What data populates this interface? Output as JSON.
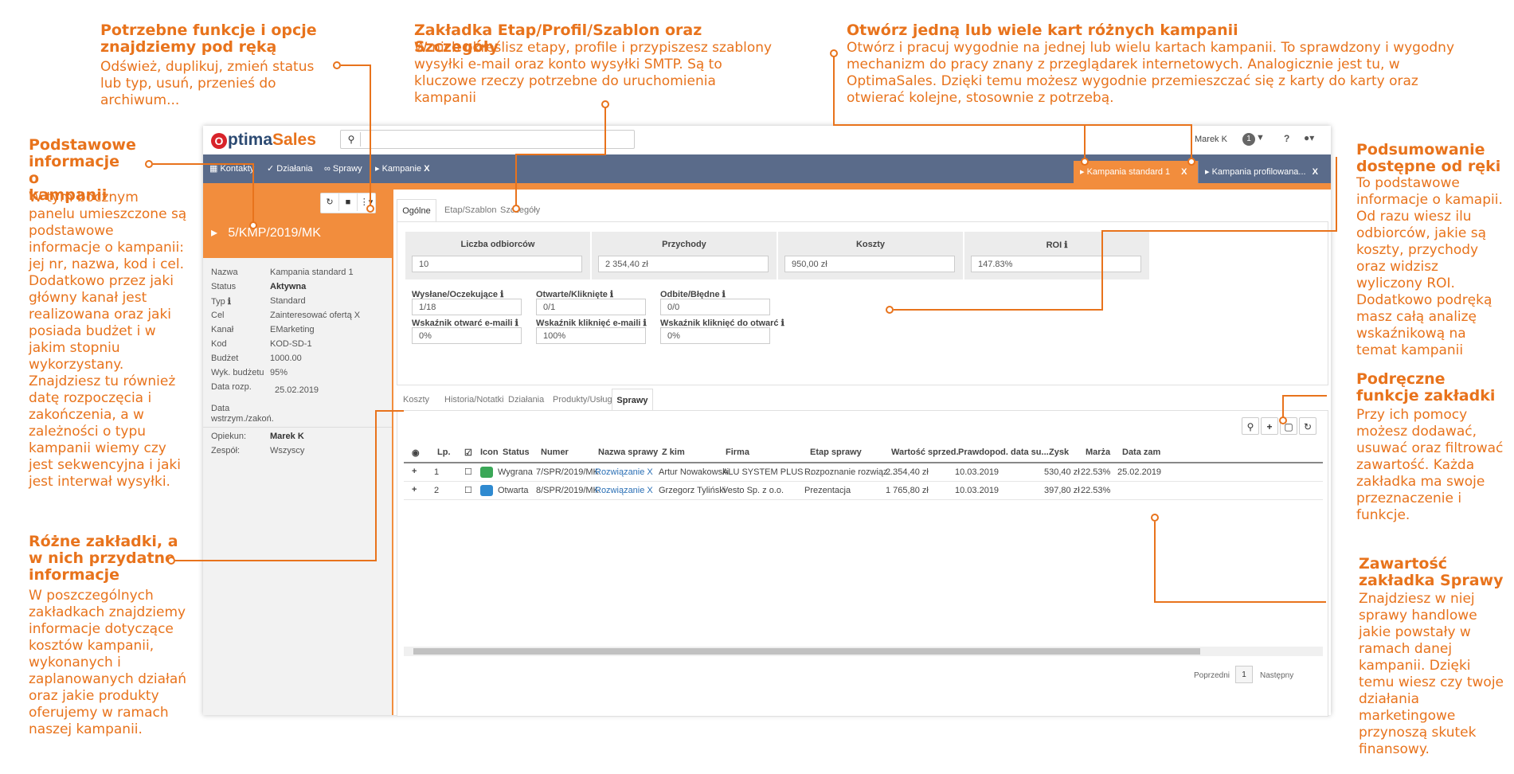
{
  "annotations": {
    "functions": {
      "title": "Potrzebne funkcje i opcje znajdziemy pod ręką",
      "body": "Odśwież, duplikuj, zmień status lub typ, usuń, przenieś do archiwum..."
    },
    "stage_tab": {
      "title": "Zakładka Etap/Profil/Szablon oraz Szczegóły",
      "body": "W nich określisz etapy, profile i przypiszesz szablony wysyłki e-mail oraz konto wysyłki SMTP. Są to kluczowe rzeczy potrzebne do uruchomienia kampanii"
    },
    "open_tabs": {
      "title": "Otwórz jedną lub wiele kart różnych kampanii",
      "body": "Otwórz i pracuj wygodnie na jednej lub wielu kartach kampanii. To sprawdzony i wygodny mechanizm do pracy znany z przeglądarek internetowych. Analogicznie jest tu, w OptimaSales. Dzięki temu możesz wygodnie przemieszczać się z karty do karty oraz otwierać kolejne, stosownie z potrzebą."
    },
    "basic_info": {
      "title": "Podstawowe informacje o kampanii",
      "body": "W tym bocznym panelu umieszczone są podstawowe informacje o kampanii: jej nr, nazwa, kod i cel. Dodatkowo przez jaki główny kanał jest realizowana oraz jaki posiada budżet i w jakim stopniu wykorzystany. Znajdziesz tu również datę rozpoczęcia i zakończenia, a w zależności o typu kampanii wiemy czy jest sekwencyjna i jaki jest interwał wysyłki."
    },
    "summary": {
      "title": "Podsumowanie dostępne od ręki",
      "body": "To podstawowe informacje o kamapii. Od razu wiesz ilu odbiorców, jakie są koszty, przychody oraz widzisz wyliczony ROI. Dodatkowo podręką masz całą analizę wskaźnikową na temat kampanii"
    },
    "handy": {
      "title": "Podręczne funkcje zakładki",
      "body": "Przy ich pomocy możesz dodawać, usuwać oraz filtrować zawartość. Każda zakładka ma swoje przeznaczenie i funkcje."
    },
    "tabs_info": {
      "title": "Różne zakładki, a w nich przydatne informacje",
      "body": "W poszczególnych zakładkach znajdziemy informacje dotyczące kosztów kampanii, wykonanych i zaplanowanych działań oraz jakie produkty oferujemy w ramach naszej kampanii."
    },
    "deals": {
      "title": "Zawartość zakładka Sprawy",
      "body": "Znajdziesz w niej sprawy handlowe jakie powstały w ramach danej kampanii. Dzięki temu wiesz czy twoje działania marketingowe przynoszą skutek finansowy."
    }
  },
  "app": {
    "logo_o": "O",
    "logo_rest_1": "ptima",
    "logo_rest_2": "Sales",
    "user": "Marek K",
    "notif_count": "1",
    "help": "?",
    "nav": [
      "Kontakty",
      "Działania",
      "Sprawy",
      "Kampanie"
    ],
    "nav_close": "X",
    "tab_active": "Kampania standard 1",
    "tab_active_close": "X",
    "tab_inactive": "Kampania profilowana...",
    "tab_inactive_close": "X"
  },
  "campaign": {
    "number": "5/KMP/2019/MK",
    "fields": [
      {
        "label": "Nazwa",
        "value": "Kampania standard 1"
      },
      {
        "label": "Status",
        "value": "Aktywna"
      },
      {
        "label": "Typ",
        "value": "Standard"
      },
      {
        "label": "Cel",
        "value": "Zainteresować ofertą X"
      },
      {
        "label": "Kanał",
        "value": "EMarketing"
      },
      {
        "label": "Kod",
        "value": "KOD-SD-1"
      },
      {
        "label": "Budżet",
        "value": "1000.00"
      },
      {
        "label": "Wyk. budżetu",
        "value": "95%"
      },
      {
        "label": "Data rozp.",
        "value": "25.02.2019"
      },
      {
        "label": "Data wstrzym./zakoń.",
        "value": ""
      },
      {
        "label": "Opiekun:",
        "value": "Marek K"
      },
      {
        "label": "Zespół:",
        "value": "Wszyscy"
      }
    ]
  },
  "top_tabs": [
    "Ogólne",
    "Etap/Szablon",
    "Szczegóły"
  ],
  "stats": [
    {
      "label": "Liczba odbiorców",
      "value": "10"
    },
    {
      "label": "Przychody",
      "value": "2 354,40 zł"
    },
    {
      "label": "Koszty",
      "value": "950,00 zł"
    },
    {
      "label": "ROI",
      "value": "147.83%"
    }
  ],
  "metrics": [
    {
      "label": "Wysłane/Oczekujące",
      "value": "1/18"
    },
    {
      "label": "Otwarte/Kliknięte",
      "value": "0/1"
    },
    {
      "label": "Odbite/Błędne",
      "value": "0/0"
    },
    {
      "label": "Wskaźnik otwarć e-maili",
      "value": "0%"
    },
    {
      "label": "Wskaźnik kliknięć e-maili",
      "value": "100%"
    },
    {
      "label": "Wskaźnik kliknięć do otwarć",
      "value": "0%"
    }
  ],
  "info_glyph": "ℹ",
  "bottom_tabs": [
    "Koszty",
    "Historia/Notatki",
    "Działania",
    "Produkty/Usługi",
    "Sprawy"
  ],
  "table": {
    "headers": [
      "Lp.",
      "Icon",
      "Status",
      "Numer",
      "Nazwa sprawy",
      "Z kim",
      "Firma",
      "Etap sprawy",
      "Wartość sprzed.",
      "Prawdopod. data su...",
      "Zysk",
      "Marża",
      "Data zam"
    ],
    "rows": [
      {
        "lp": "1",
        "status": "Wygrana",
        "numer": "7/SPR/2019/MK",
        "nazwa": "Rozwiązanie X",
        "zkim": "Artur Nowakowski",
        "firma": "ALU SYSTEM PLUS ...",
        "etap": "Rozpoznanie rozwiąz...",
        "wartosc": "2 354,40 zł",
        "data": "10.03.2019",
        "zysk": "530,40 zł",
        "marza": "22.53%",
        "datazam": "25.02.2019"
      },
      {
        "lp": "2",
        "status": "Otwarta",
        "numer": "8/SPR/2019/MK",
        "nazwa": "Rozwiązanie X",
        "zkim": "Grzegorz Tyliński",
        "firma": "Vesto Sp. z o.o.",
        "etap": "Prezentacja",
        "wartosc": "1 765,80 zł",
        "data": "10.03.2019",
        "zysk": "397,80 zł",
        "marza": "22.53%",
        "datazam": ""
      }
    ]
  },
  "pagination": {
    "prev": "Poprzedni",
    "page": "1",
    "next": "Następny"
  }
}
